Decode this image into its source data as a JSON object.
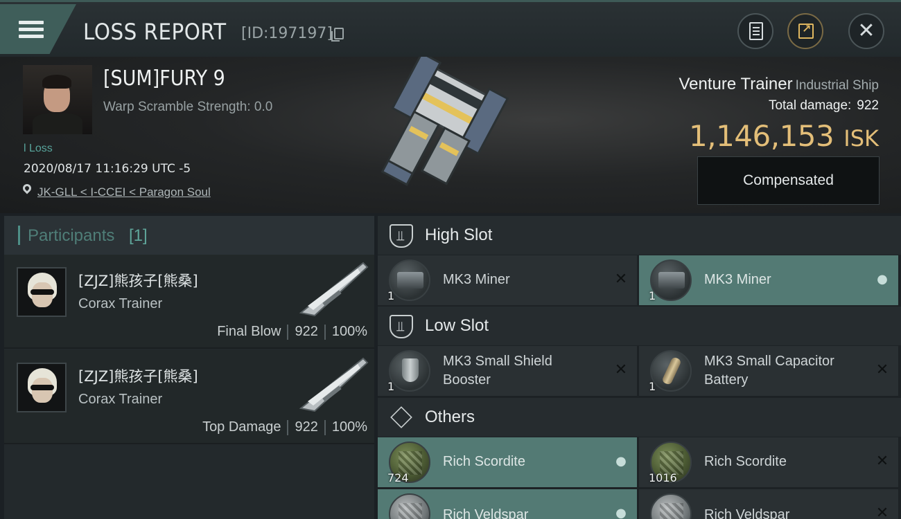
{
  "header": {
    "title": "LOSS REPORT",
    "report_id": "[ID:197197]"
  },
  "victim": {
    "name": "[SUM]FURY 9",
    "warp_scramble": "Warp Scramble Strength: 0.0",
    "loss_tag": "l Loss",
    "datetime": "2020/08/17 11:16:29 UTC -5",
    "location": "JK-GLL < I-CCEI < Paragon Soul"
  },
  "ship": {
    "name": "Venture Trainer",
    "class": "Industrial Ship",
    "total_damage_label": "Total damage:",
    "total_damage": "922",
    "isk_value": "1,146,153",
    "isk_unit": "ISK",
    "status_button": "Compensated"
  },
  "participants": {
    "title": "Participants",
    "count": "[1]",
    "rows": [
      {
        "name": "[ZJZ]熊孩子[熊桑]",
        "ship": "Corax Trainer",
        "role": "Final Blow",
        "damage": "922",
        "percent": "100%"
      },
      {
        "name": "[ZJZ]熊孩子[熊桑]",
        "ship": "Corax Trainer",
        "role": "Top Damage",
        "damage": "922",
        "percent": "100%"
      }
    ]
  },
  "slots": {
    "high": {
      "title": "High Slot",
      "items": [
        {
          "name": "MK3 Miner",
          "qty": "1",
          "status": "destroyed"
        },
        {
          "name": "MK3 Miner",
          "qty": "1",
          "status": "dropped"
        }
      ]
    },
    "low": {
      "title": "Low Slot",
      "items": [
        {
          "name_line1": "MK3 Small Shield",
          "name_line2": "Booster",
          "qty": "1",
          "status": "destroyed"
        },
        {
          "name_line1": "MK3 Small Capacitor",
          "name_line2": "Battery",
          "qty": "1",
          "status": "destroyed"
        }
      ]
    },
    "others": {
      "title": "Others",
      "items": [
        {
          "name": "Rich Scordite",
          "qty": "724",
          "status": "dropped"
        },
        {
          "name": "Rich Scordite",
          "qty": "1016",
          "status": "destroyed"
        },
        {
          "name": "Rich Veldspar",
          "status": "dropped"
        },
        {
          "name": "Rich Veldspar",
          "status": "destroyed"
        }
      ]
    }
  },
  "icons": {
    "destroyed": "✕",
    "dropped": "👤"
  },
  "colors": {
    "accent_teal": "#537a74",
    "isk_gold": "#e3be78",
    "loss_green": "#58a49b"
  }
}
